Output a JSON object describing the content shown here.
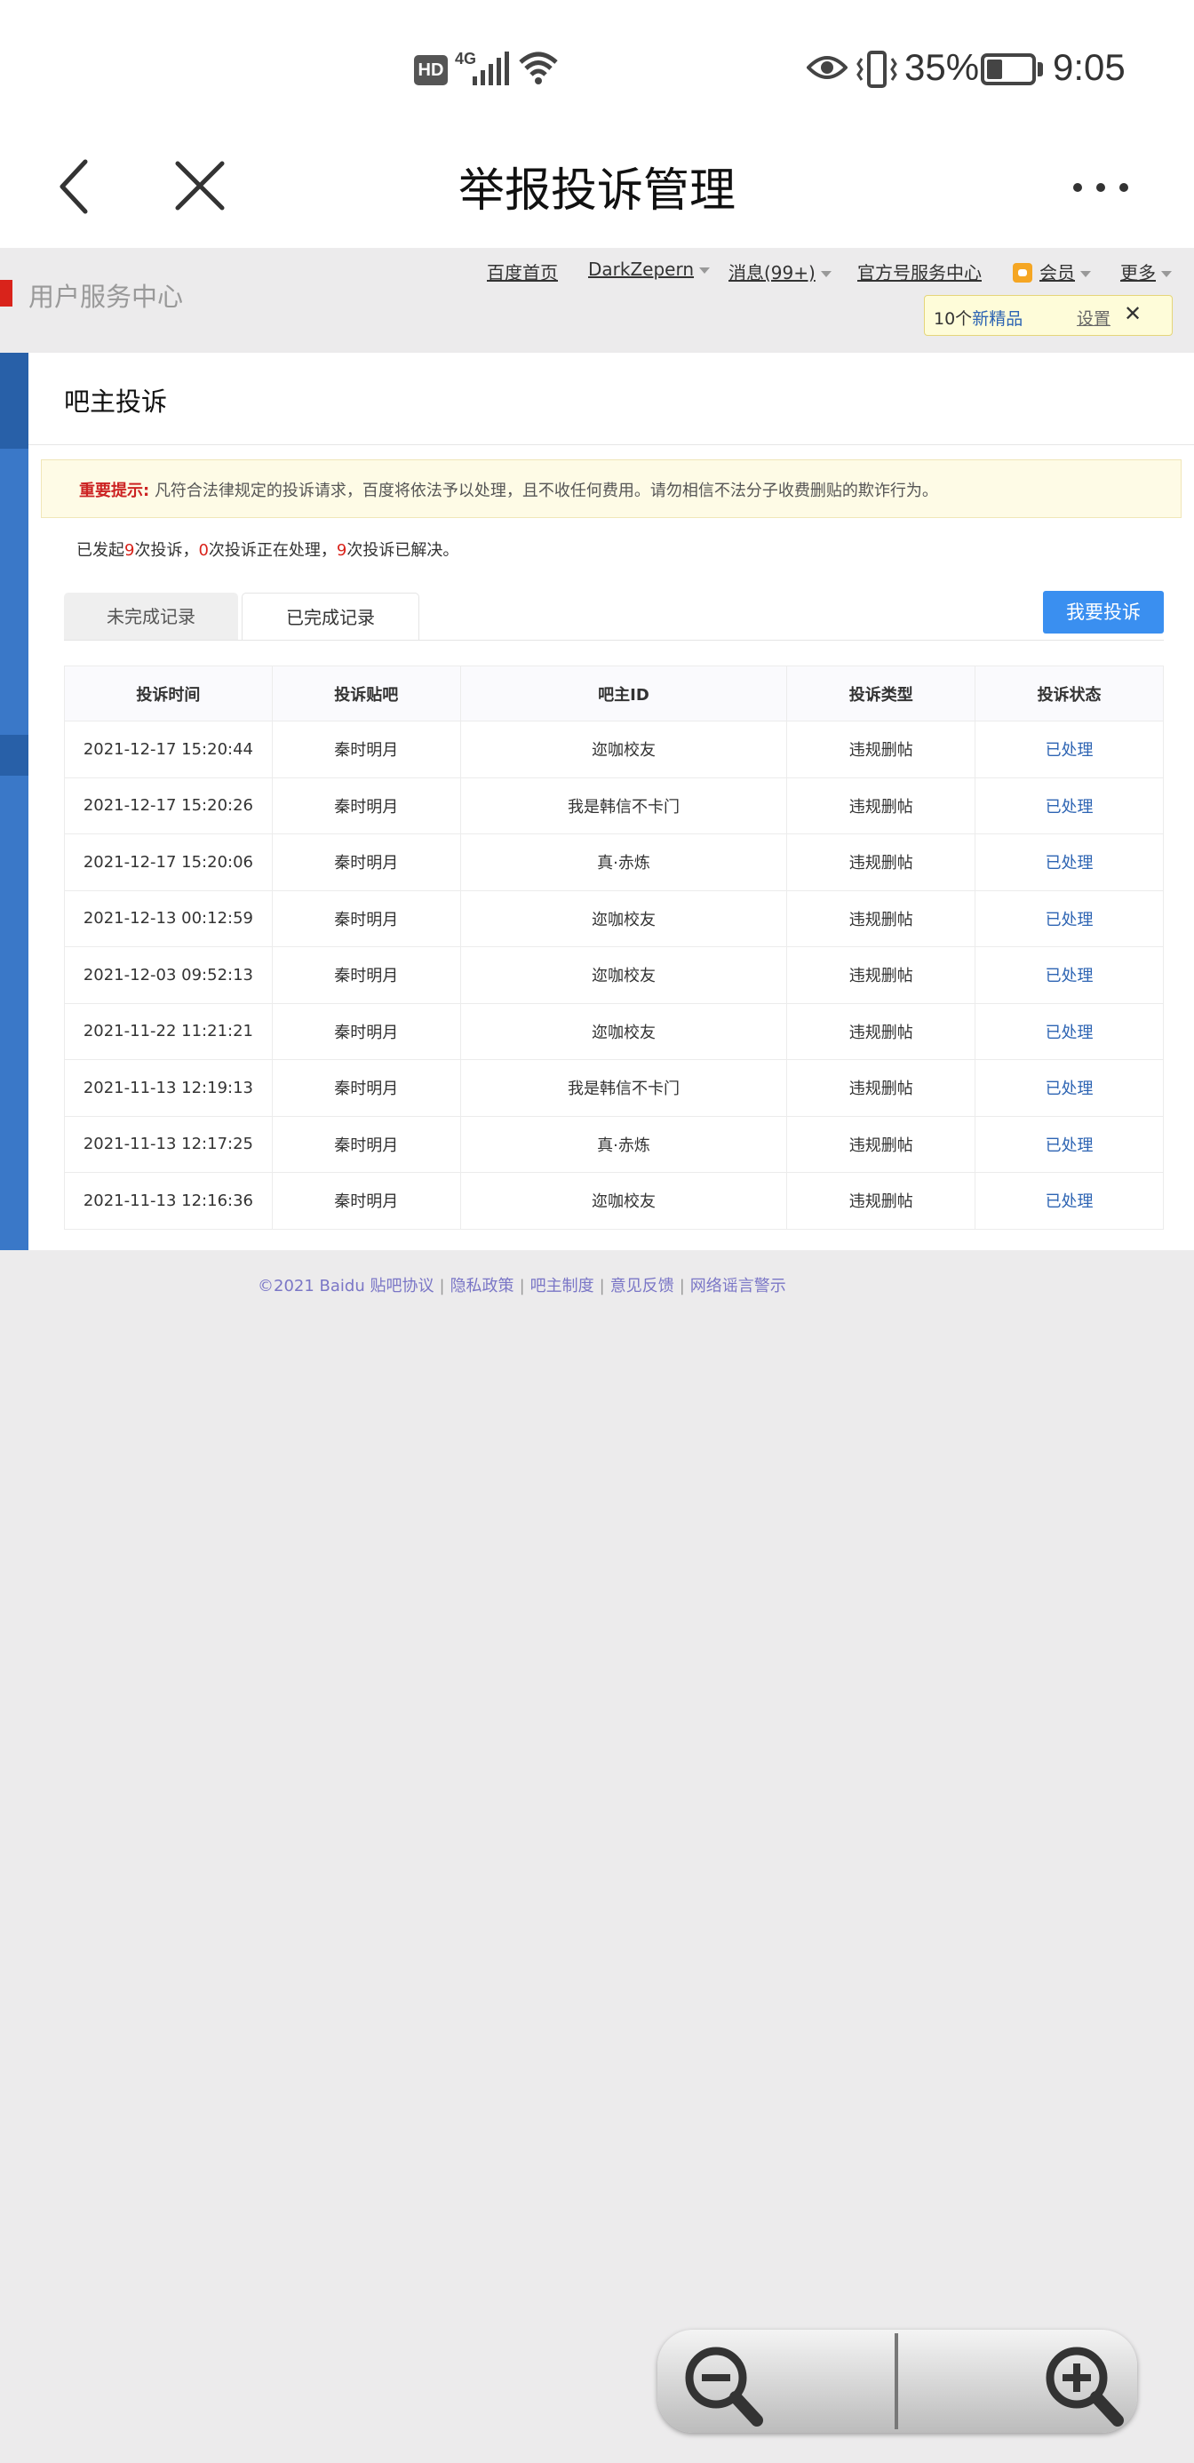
{
  "status_bar": {
    "hd": "HD",
    "network": "4G",
    "battery_percent": "35%",
    "battery_level": 0.35,
    "time": "9:05"
  },
  "title_bar": {
    "title": "举报投诉管理",
    "back_icon": "chevron-left-icon",
    "close_icon": "close-icon",
    "more_icon": "more-dots-icon"
  },
  "site": {
    "logo_text": "用户服务中心",
    "nav": {
      "home": "百度首页",
      "user": "DarkZepern",
      "messages": "消息(99+)",
      "official": "官方号服务中心",
      "vip": "会员",
      "more": "更多"
    },
    "tip": {
      "count_prefix": "10个",
      "count_link": "新精品",
      "settings": "设置",
      "close": "✕"
    }
  },
  "panel": {
    "title": "吧主投诉",
    "notice_label": "重要提示:",
    "notice_text": "凡符合法律规定的投诉请求，百度将依法予以处理，且不收任何费用。请勿相信不法分子收费删贴的欺诈行为。",
    "summary": {
      "p1": "已发起",
      "total": "9",
      "p2": "次投诉，",
      "processing": "0",
      "p3": "次投诉正在处理，",
      "resolved": "9",
      "p4": "次投诉已解决。"
    },
    "tabs": {
      "incomplete": "未完成记录",
      "complete": "已完成记录"
    },
    "complain_button": "我要投诉"
  },
  "table": {
    "headers": [
      "投诉时间",
      "投诉贴吧",
      "吧主ID",
      "投诉类型",
      "投诉状态"
    ],
    "rows": [
      [
        "2021-12-17 15:20:44",
        "秦时明月",
        "迩咖校友",
        "违规删帖",
        "已处理"
      ],
      [
        "2021-12-17 15:20:26",
        "秦时明月",
        "我是韩信不卡门",
        "违规删帖",
        "已处理"
      ],
      [
        "2021-12-17 15:20:06",
        "秦时明月",
        "真·赤炼",
        "违规删帖",
        "已处理"
      ],
      [
        "2021-12-13 00:12:59",
        "秦时明月",
        "迩咖校友",
        "违规删帖",
        "已处理"
      ],
      [
        "2021-12-03 09:52:13",
        "秦时明月",
        "迩咖校友",
        "违规删帖",
        "已处理"
      ],
      [
        "2021-11-22 11:21:21",
        "秦时明月",
        "迩咖校友",
        "违规删帖",
        "已处理"
      ],
      [
        "2021-11-13 12:19:13",
        "秦时明月",
        "我是韩信不卡门",
        "违规删帖",
        "已处理"
      ],
      [
        "2021-11-13 12:17:25",
        "秦时明月",
        "真·赤炼",
        "违规删帖",
        "已处理"
      ],
      [
        "2021-11-13 12:16:36",
        "秦时明月",
        "迩咖校友",
        "违规删帖",
        "已处理"
      ]
    ]
  },
  "footer": {
    "copyright": "©2021 Baidu",
    "links": [
      "贴吧协议",
      "隐私政策",
      "吧主制度",
      "意见反馈",
      "网络谣言警示"
    ]
  },
  "zoom": {
    "out_icon": "zoom-out-icon",
    "in_icon": "zoom-in-icon"
  }
}
